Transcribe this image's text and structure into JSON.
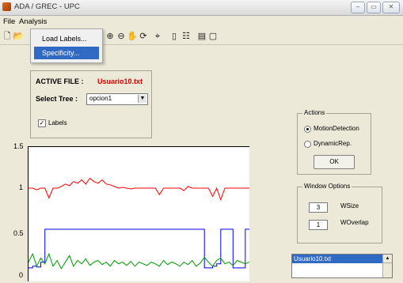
{
  "window": {
    "title": "ADA / GREC - UPC",
    "buttons": [
      "–",
      "▭",
      "✕"
    ]
  },
  "menubar": {
    "items": [
      "File",
      "Analysis"
    ]
  },
  "toolbar": {
    "icons": [
      "new-file-icon",
      "open-file-icon",
      "zoom-in-icon",
      "zoom-out-icon",
      "pan-icon",
      "rotate-icon",
      "data-cursor-icon",
      "colorbar-icon",
      "legend-icon",
      "hide-plot-tools-icon",
      "show-plot-tools-icon"
    ]
  },
  "analysis_menu": {
    "items": [
      "Load Labels...",
      "Specificity..."
    ],
    "highlighted_index": 1
  },
  "file_panel": {
    "active_file_label": "ACTIVE FILE :",
    "active_file_value": "Usuario10.txt",
    "select_tree_label": "Select Tree :",
    "select_tree_value": "opcion1",
    "labels_checkbox": "Labels",
    "labels_checked": true
  },
  "actions": {
    "title": "Actions",
    "options": [
      "MotionDetection",
      "DynamicRep."
    ],
    "selected": 0,
    "ok_label": "OK"
  },
  "window_options": {
    "title": "Window Options",
    "wsize_value": "3",
    "wsize_label": "WSize",
    "woverlap_value": "1",
    "woverlap_label": "WOverlap"
  },
  "file_list": {
    "selected": "Usuario10.txt"
  },
  "chart_data": {
    "type": "line",
    "y_ticks": [
      "1.5",
      "1",
      "0.5",
      "0"
    ],
    "ylim": [
      0,
      1.5
    ],
    "series": [
      {
        "color": "#ff0000",
        "values": [
          1.0,
          1.0,
          0.98,
          1.0,
          1.0,
          0.88,
          1.0,
          1.0,
          1.02,
          1.05,
          1.03,
          1.08,
          1.06,
          1.1,
          1.05,
          1.12,
          1.08,
          1.06,
          1.1,
          1.05,
          1.04,
          1.02,
          1.0,
          1.01,
          1.0,
          0.99,
          1.0,
          1.0,
          1.0,
          1.0,
          1.0,
          1.0,
          0.92,
          1.0,
          1.0,
          1.0,
          1.0,
          1.0,
          0.97,
          1.02,
          1.0,
          1.0,
          1.0,
          1.0,
          1.0,
          0.9,
          1.0,
          0.86,
          1.0,
          1.0,
          1.0,
          1.0,
          1.0,
          1.0,
          1.0
        ]
      },
      {
        "color": "#0000ff",
        "values": [
          0.03,
          0.05,
          0.04,
          0.1,
          0.5,
          0.5,
          0.5,
          0.5,
          0.5,
          0.5,
          0.5,
          0.5,
          0.5,
          0.5,
          0.5,
          0.5,
          0.5,
          0.5,
          0.5,
          0.5,
          0.5,
          0.5,
          0.5,
          0.5,
          0.5,
          0.5,
          0.5,
          0.5,
          0.5,
          0.5,
          0.5,
          0.5,
          0.5,
          0.5,
          0.5,
          0.5,
          0.5,
          0.5,
          0.5,
          0.5,
          0.5,
          0.5,
          0.5,
          0.03,
          0.03,
          0.05,
          0.08,
          0.5,
          0.5,
          0.5,
          0.03,
          0.03,
          0.03,
          0.5,
          0.5
        ]
      },
      {
        "color": "#009900",
        "values": [
          0.1,
          0.2,
          0.05,
          0.15,
          0.08,
          0.2,
          0.05,
          0.12,
          0.02,
          0.1,
          0.18,
          0.05,
          0.12,
          0.08,
          0.14,
          0.06,
          0.1,
          0.12,
          0.07,
          0.1,
          0.05,
          0.12,
          0.08,
          0.1,
          0.06,
          0.11,
          0.05,
          0.1,
          0.08,
          0.06,
          0.1,
          0.08,
          0.05,
          0.12,
          0.07,
          0.1,
          0.08,
          0.05,
          0.1,
          0.07,
          0.12,
          0.05,
          0.09,
          0.16,
          0.1,
          0.05,
          0.12,
          0.15,
          0.08,
          0.1,
          0.06,
          0.12,
          0.1,
          0.08,
          0.1
        ]
      }
    ]
  }
}
